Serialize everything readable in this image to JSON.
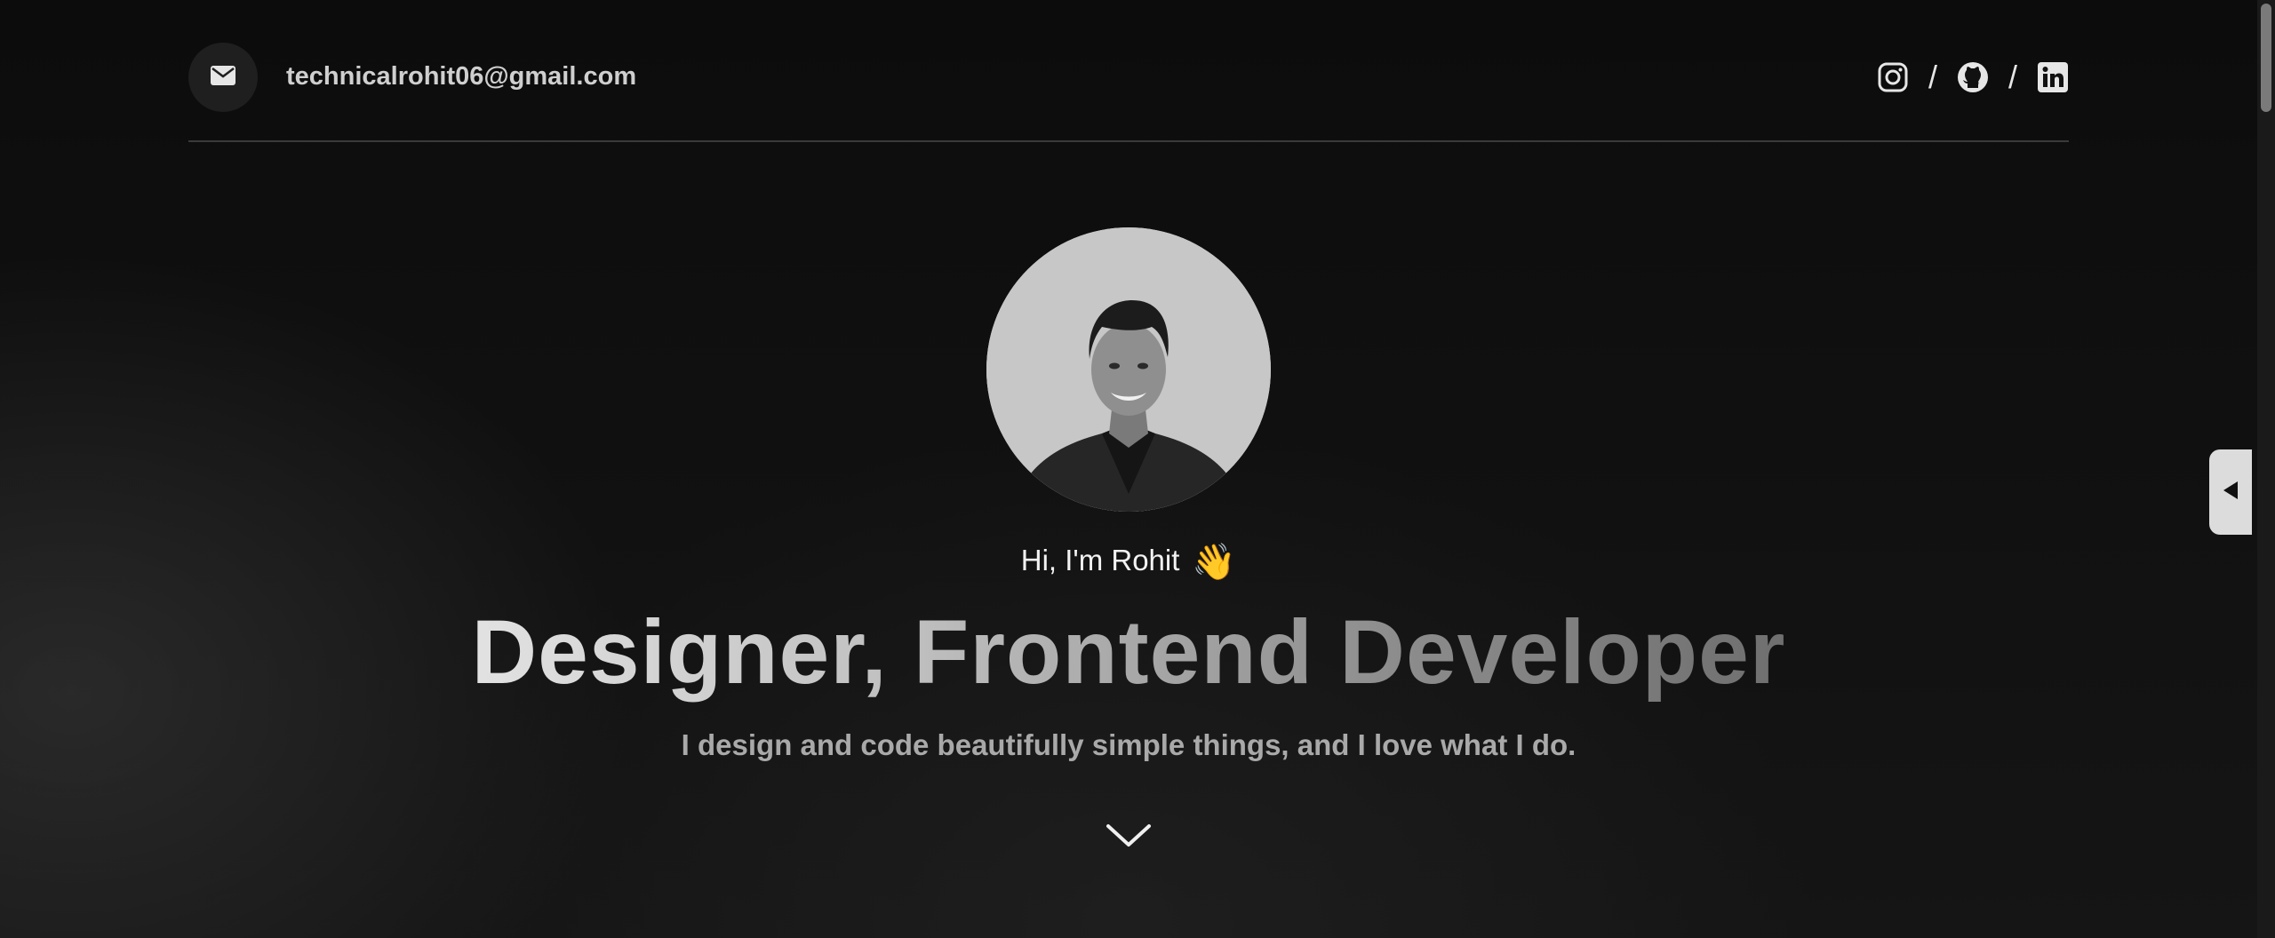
{
  "header": {
    "email": "technicalrohit06@gmail.com",
    "icons": {
      "mail": "envelope-icon",
      "instagram": "instagram-icon",
      "github": "github-icon",
      "linkedin": "linkedin-icon"
    },
    "separator": "/"
  },
  "hero": {
    "greeting": "Hi, I'm Rohit",
    "wave_emoji": "👋",
    "title": "Designer, Frontend Developer",
    "subtitle": "I design and code beautifully simple things, and I love what I do.",
    "scroll_icon": "chevron-down-icon",
    "avatar": "profile-photo"
  },
  "side_tab": {
    "icon": "triangle-left-icon"
  },
  "colors": {
    "background": "#0b0b0b",
    "text_primary": "#f2f2f2",
    "text_secondary": "#a9a9a9",
    "avatar_bg": "#c7c7c7"
  }
}
